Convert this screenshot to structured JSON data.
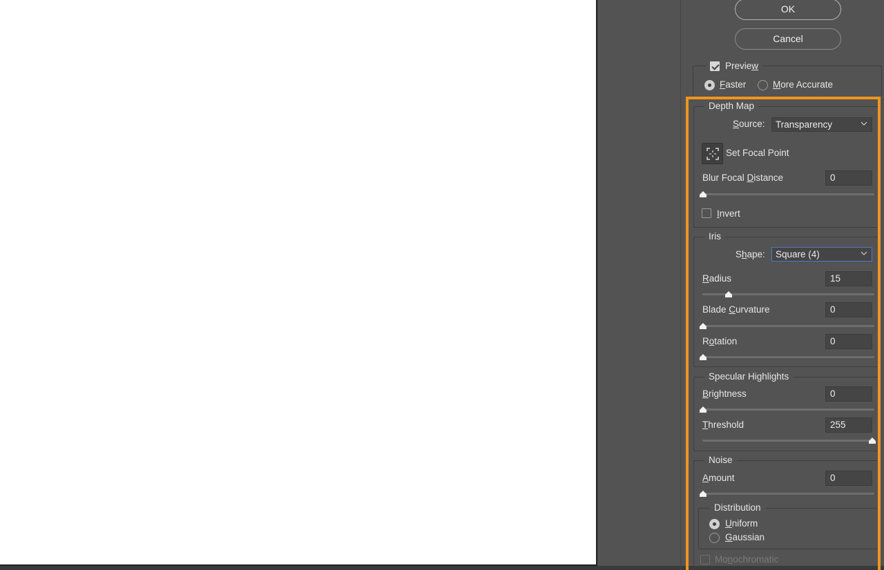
{
  "buttons": {
    "ok": "OK",
    "cancel": "Cancel"
  },
  "preview": {
    "label_pre": "Previe",
    "label_ul": "w",
    "checked": true,
    "faster": {
      "ul": "F",
      "rest": "aster",
      "selected": true
    },
    "more_accurate": {
      "ul": "M",
      "rest": "ore Accurate",
      "selected": false
    }
  },
  "depth_map": {
    "legend": "Depth Map",
    "source_label_ul": "S",
    "source_label_rest": "ource:",
    "source_value": "Transparency",
    "set_focal_point": "Set Focal Point",
    "blur_label_pre": "Blur Focal ",
    "blur_label_ul": "D",
    "blur_label_rest": "istance",
    "blur_value": "0",
    "blur_level": 0,
    "invert_ul": "I",
    "invert_rest": "nvert",
    "invert_checked": false
  },
  "iris": {
    "legend": "Iris",
    "shape_label_pre": "S",
    "shape_label_ul": "h",
    "shape_label_rest": "ape:",
    "shape_value": "Square (4)",
    "radius_ul": "R",
    "radius_rest": "adius",
    "radius_value": "15",
    "radius_level": 0.15,
    "blade_pre": "Blade ",
    "blade_ul": "C",
    "blade_rest": "urvature",
    "blade_value": "0",
    "blade_level": 0,
    "rotation_pre": "R",
    "rotation_ul": "o",
    "rotation_rest": "tation",
    "rotation_value": "0",
    "rotation_level": 0
  },
  "specular": {
    "legend": "Specular Highlights",
    "brightness_ul": "B",
    "brightness_rest": "rightness",
    "brightness_value": "0",
    "brightness_level": 0,
    "threshold_ul": "T",
    "threshold_rest": "hreshold",
    "threshold_value": "255",
    "threshold_level": 1
  },
  "noise": {
    "legend": "Noise",
    "amount_ul": "A",
    "amount_rest": "mount",
    "amount_value": "0",
    "amount_level": 0,
    "distribution_legend": "Distribution",
    "uniform_ul": "U",
    "uniform_rest": "niform",
    "uniform_selected": true,
    "gaussian_ul": "G",
    "gaussian_rest": "aussian",
    "gaussian_selected": false,
    "mono_pre": "Mo",
    "mono_ul": "n",
    "mono_rest": "ochromatic",
    "mono_checked": false
  },
  "colors": {
    "highlight": "#f0951e",
    "panel_bg": "#535353",
    "focus": "#4a7ac8"
  },
  "icons": {
    "chevron": "chevron-down-icon",
    "focal": "focal-point-icon",
    "thumb": "slider-thumb-icon"
  }
}
